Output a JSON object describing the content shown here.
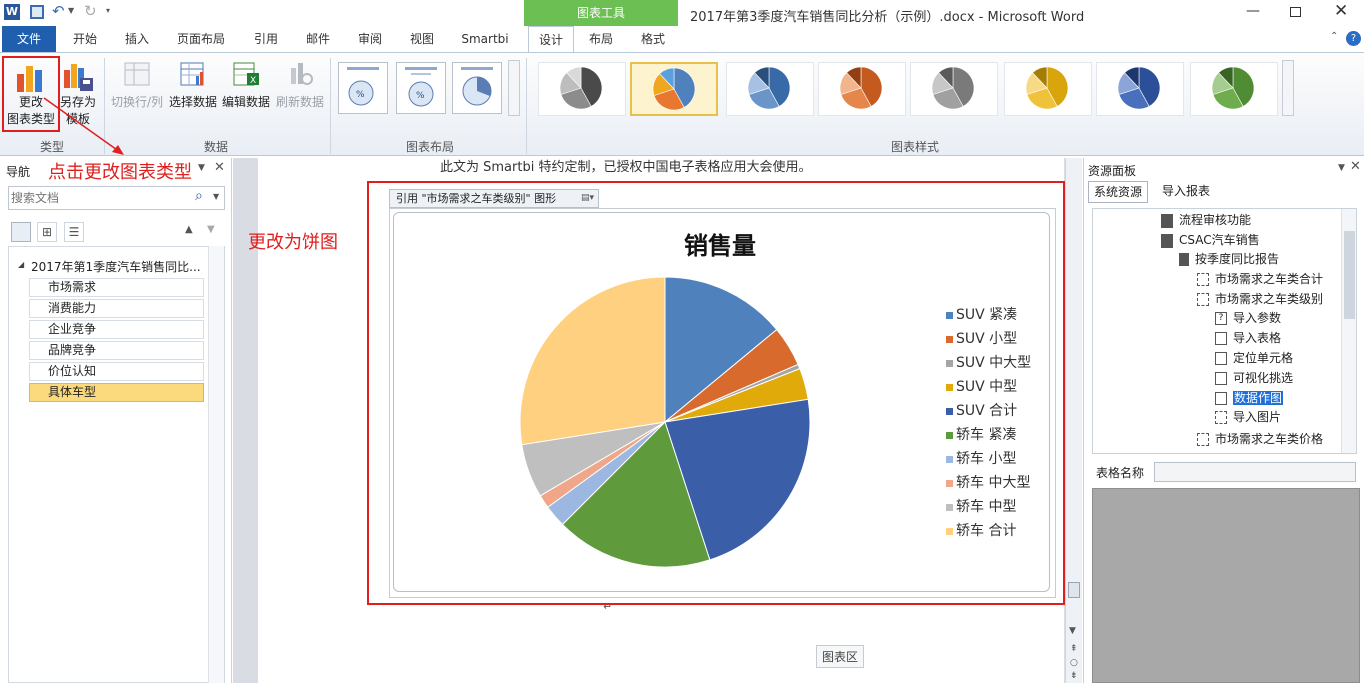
{
  "window": {
    "title": "2017年第3季度汽车销售同比分析（示例）.docx - Microsoft Word",
    "context_tab_header": "图表工具"
  },
  "ribbon": {
    "tabs": [
      "文件",
      "开始",
      "插入",
      "页面布局",
      "引用",
      "邮件",
      "审阅",
      "视图",
      "Smartbi"
    ],
    "context_tabs": [
      "设计",
      "布局",
      "格式"
    ],
    "type_group": {
      "label": "类型",
      "change_type_l1": "更改",
      "change_type_l2": "图表类型",
      "save_template_l1": "另存为",
      "save_template_l2": "模板"
    },
    "data_group": {
      "label": "数据",
      "switch_row_col": "切换行/列",
      "select_data": "选择数据",
      "edit_data": "编辑数据",
      "refresh_data": "刷新数据"
    },
    "layout_group": {
      "label": "图表布局"
    },
    "styles_group": {
      "label": "图表样式"
    }
  },
  "annotations": {
    "click_note": "点击更改图表类型",
    "pie_note": "更改为饼图"
  },
  "nav": {
    "title": "导航",
    "search_placeholder": "搜索文档",
    "root": "2017年第1季度汽车销售同比...",
    "items": [
      "市场需求",
      "消费能力",
      "企业竞争",
      "品牌竞争",
      "价位认知",
      "具体车型"
    ]
  },
  "doc": {
    "top_text": "此文为 Smartbi 特约定制，已授权中国电子表格应用大会使用。",
    "content_control_label": "引用 \"市场需求之车类级别\" 图形",
    "chart_area_tooltip": "图表区"
  },
  "chart_data": {
    "type": "pie",
    "title": "销售量",
    "categories": [
      "SUV 紧凑",
      "SUV 小型",
      "SUV 中大型",
      "SUV 中型",
      "SUV 合计",
      "轿车 紧凑",
      "轿车 小型",
      "轿车 中大型",
      "轿车 中型",
      "轿车 合计"
    ],
    "values": [
      14,
      4.5,
      0.5,
      3.5,
      22.5,
      17.5,
      2.5,
      1.5,
      6,
      27.5
    ],
    "colors": [
      "#4f81bd",
      "#d86a2e",
      "#a5a5a5",
      "#e0aa0b",
      "#3a5ea8",
      "#5f9a3c",
      "#9cb8e0",
      "#efa689",
      "#bfbfbf",
      "#fed07f"
    ],
    "legend_position": "right"
  },
  "resources": {
    "title": "资源面板",
    "tabs": [
      "系统资源",
      "导入报表"
    ],
    "tree": [
      "流程审核功能",
      "CSAC汽车销售",
      "按季度同比报告",
      "市场需求之车类合计",
      "市场需求之车类级别",
      "导入参数",
      "导入表格",
      "定位单元格",
      "可视化挑选",
      "数据作图",
      "导入图片",
      "市场需求之车类价格"
    ],
    "table_name_label": "表格名称"
  },
  "colors": {
    "accent_blue": "#1f5fae",
    "context_green": "#6cbf52",
    "annotation_red": "#e01e1e",
    "nav_active": "#fbd97d"
  }
}
